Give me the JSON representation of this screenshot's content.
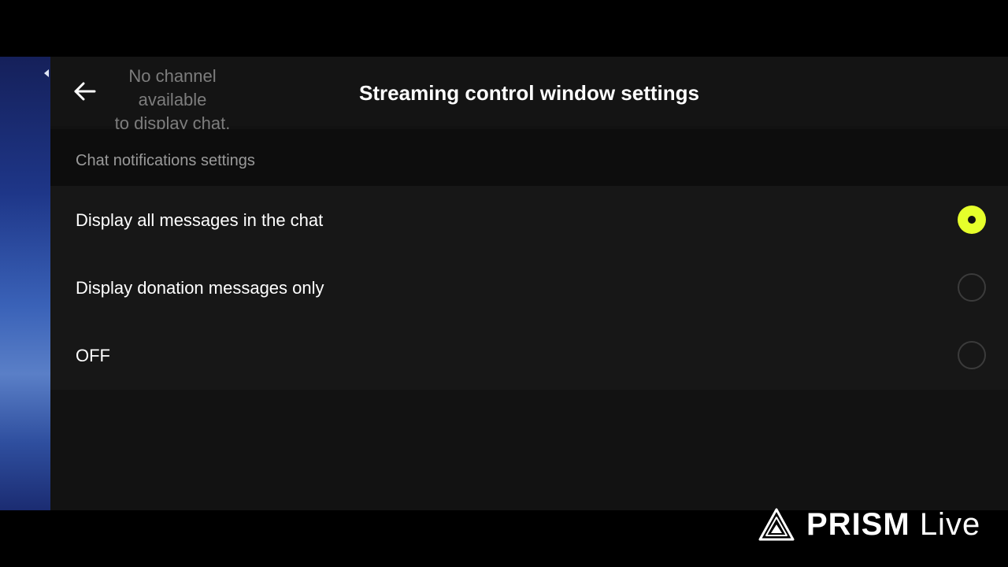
{
  "header": {
    "title": "Streaming control window settings",
    "back_icon": "arrow-left-icon"
  },
  "overlay": {
    "text": "No channel\navailable\nto display chat."
  },
  "section": {
    "label": "Chat notifications settings"
  },
  "options": [
    {
      "label": "Display all messages in the chat",
      "selected": true
    },
    {
      "label": "Display donation messages only",
      "selected": false
    },
    {
      "label": "OFF",
      "selected": false
    }
  ],
  "colors": {
    "accent": "#E6FF2B",
    "panel_background": "#171717",
    "section_background": "#0D0D0D"
  },
  "watermark": {
    "brand": "PRISM",
    "suffix": "Live",
    "icon": "prism-logo-icon"
  }
}
